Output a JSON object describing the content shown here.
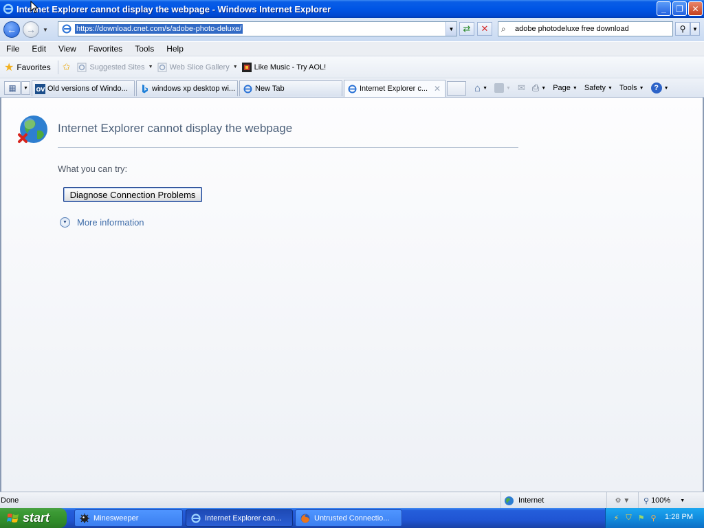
{
  "window": {
    "title": "Internet Explorer cannot display the webpage - Windows Internet Explorer",
    "minimize_label": "_",
    "restore_label": "❐",
    "close_label": "✕"
  },
  "address_bar": {
    "url": "https://download.cnet.com/s/adobe-photo-deluxe/"
  },
  "search": {
    "query": "adobe photodeluxe free download"
  },
  "menu": {
    "items": [
      "File",
      "Edit",
      "View",
      "Favorites",
      "Tools",
      "Help"
    ]
  },
  "favorites_bar": {
    "favorites_label": "Favorites",
    "links": [
      {
        "label": "Suggested Sites"
      },
      {
        "label": "Web Slice Gallery"
      },
      {
        "label": "Like Music - Try AOL!"
      }
    ]
  },
  "tabs": [
    {
      "label": "Old versions of Windo...",
      "icon": "ov-icon"
    },
    {
      "label": "windows xp desktop wi...",
      "icon": "bing-icon"
    },
    {
      "label": "New Tab",
      "icon": "ie-icon"
    },
    {
      "label": "Internet Explorer c...",
      "icon": "ie-icon",
      "active": true
    }
  ],
  "command_bar": {
    "page_label": "Page",
    "safety_label": "Safety",
    "tools_label": "Tools"
  },
  "error_page": {
    "title": "Internet Explorer cannot display the webpage",
    "try_label": "What you can try:",
    "diagnose_button": "Diagnose Connection Problems",
    "more_info": "More information"
  },
  "status_bar": {
    "status": "Done",
    "zone": "Internet",
    "zoom": "100%"
  },
  "taskbar": {
    "start_label": "start",
    "tasks": [
      {
        "label": "Minesweeper"
      },
      {
        "label": "Internet Explorer can..."
      },
      {
        "label": "Untrusted Connectio..."
      }
    ],
    "clock": "1:28 PM"
  },
  "colors": {
    "titlebar": "#0055e5",
    "error_title": "#4c607a",
    "link": "#3d6ba8",
    "start_green": "#3c9a35"
  }
}
